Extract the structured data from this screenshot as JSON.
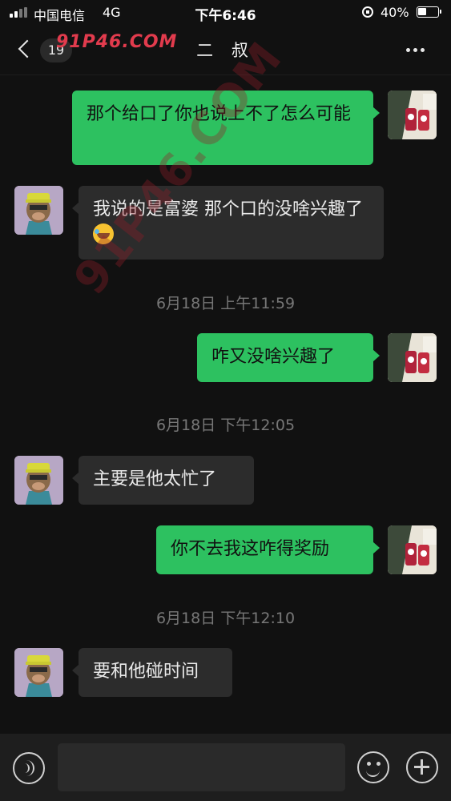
{
  "status_bar": {
    "carrier": "中国电信",
    "network": "4G",
    "time": "下午6:46",
    "battery_percent": "40%",
    "battery_level": 0.4
  },
  "nav": {
    "unread_count": "19",
    "title": "二 叔",
    "watermark": "91P46.COM"
  },
  "messages": [
    {
      "sender": "me",
      "text": "那个给口了你也说上不了怎么可能"
    },
    {
      "sender": "them",
      "text": "我说的是富婆 那个口的没啥兴趣了",
      "emoji": "laugh-cry-emoji"
    },
    {
      "timestamp": "6月18日 上午11:59"
    },
    {
      "sender": "me",
      "text": "咋又没啥兴趣了"
    },
    {
      "timestamp": "6月18日 下午12:05"
    },
    {
      "sender": "them",
      "text": "主要是他太忙了"
    },
    {
      "sender": "me",
      "text": "你不去我这咋得奖励"
    },
    {
      "timestamp": "6月18日 下午12:10"
    },
    {
      "sender": "them",
      "text": "要和他碰时间"
    }
  ],
  "overlay_watermark": "91P46.COM",
  "input_bar": {
    "placeholder": ""
  },
  "colors": {
    "background": "#111111",
    "bubble_me": "#2dc160",
    "bubble_them": "#2c2c2c",
    "timestamp": "#777777"
  }
}
